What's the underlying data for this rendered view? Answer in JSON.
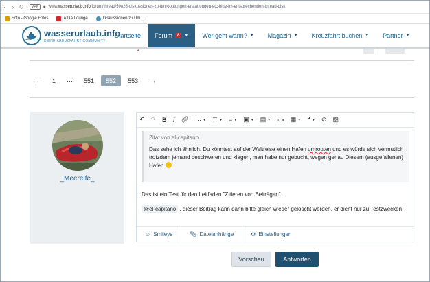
{
  "browser": {
    "vpn_label": "VPN",
    "url_prefix": "www.",
    "url_domain": "wasserurlaub.info",
    "url_path": "/forum/thread/59826-diskussionen-zu-umrooutungen-erstattungen-etc-bitte-im-entsprechenden-thread-disk"
  },
  "bookmarks": [
    {
      "label": "Foto - Google Fotos",
      "color": "#e0a100"
    },
    {
      "label": "AIDA Lounge",
      "color": "#d62828"
    },
    {
      "label": "Diskussionen zu Um...",
      "color": "#4a8bb1"
    }
  ],
  "site": {
    "logo_name": "wasserurlaub.info",
    "logo_sub": "DEINE KREUZFAHRT COMMUNITY"
  },
  "nav": {
    "startseite": "Startseite",
    "forum": "Forum",
    "forum_badge": "8",
    "werwann": "Wer geht wann?",
    "magazin": "Magazin",
    "kreuzfahrt": "Kreuzfahrt buchen",
    "partner": "Partner"
  },
  "pagination": {
    "prev": "←",
    "first": "1",
    "ellipsis": "···",
    "p1": "551",
    "current": "552",
    "p3": "553",
    "next": "→"
  },
  "user": {
    "name": "_Meerelfe_"
  },
  "editor": {
    "quote_author": "Zitat von el-capitano",
    "quote_text_1": "Das sehe ich ähnlich. Du könntest auf der Weltreise einen Hafen ",
    "quote_text_underlined": "umrouten",
    "quote_text_2": " und es würde sich vermutlich trotzdem jemand beschweren und klagen, man habe nur gebucht, wegen genau Diesem (ausgefallenen) Hafen",
    "para1": "Das ist ein Test für den Leitfaden \"Zitieren von Beiträgen\".",
    "mention": "@el-capitano",
    "para2": " , dieser Beitrag kann dann bitte gleich wieder gelöscht werden, er dient nur zu Testzwecken.",
    "footer_smileys": "Smileys",
    "footer_attachments": "Dateianhänge",
    "footer_settings": "Einstellungen"
  },
  "buttons": {
    "preview": "Vorschau",
    "reply": "Antworten"
  },
  "colors": {
    "brand": "#2b5f83",
    "nav_active": "#2b5f83",
    "badge": "#d62828",
    "reply_button": "#20506f"
  }
}
